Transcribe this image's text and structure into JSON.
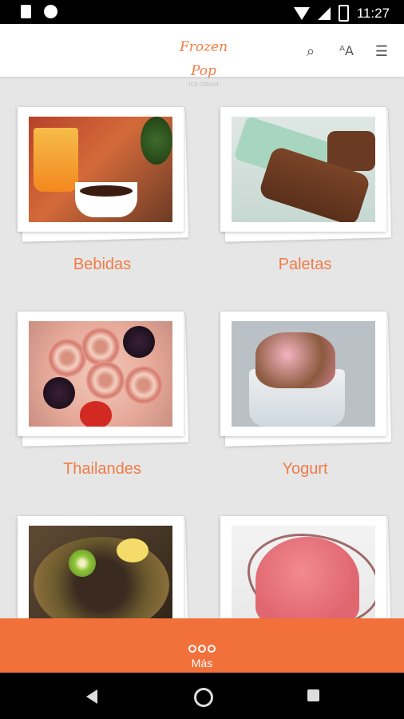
{
  "status_bar": {
    "time": "11:27",
    "icons": [
      "sd-card-icon",
      "circle-icon",
      "wifi-icon",
      "signal-icon",
      "battery-icon"
    ]
  },
  "header": {
    "logo_text": "Frozen Pop",
    "logo_sub": "· ICE CREAM ·",
    "actions": [
      {
        "name": "search-icon",
        "glyph": "🔍"
      },
      {
        "name": "font-size-icon",
        "glyph": "ᵃA"
      },
      {
        "name": "menu-icon",
        "glyph": "≡"
      }
    ]
  },
  "categories": [
    {
      "label": "Bebidas"
    },
    {
      "label": "Paletas"
    },
    {
      "label": "Thailandes"
    },
    {
      "label": "Yogurt"
    },
    {
      "label": ""
    },
    {
      "label": ""
    }
  ],
  "bottom_bar": {
    "more_label": "Más"
  },
  "colors": {
    "accent": "#ef7c47",
    "bottom_bar": "#f2703a",
    "background": "#e6e6e6"
  }
}
